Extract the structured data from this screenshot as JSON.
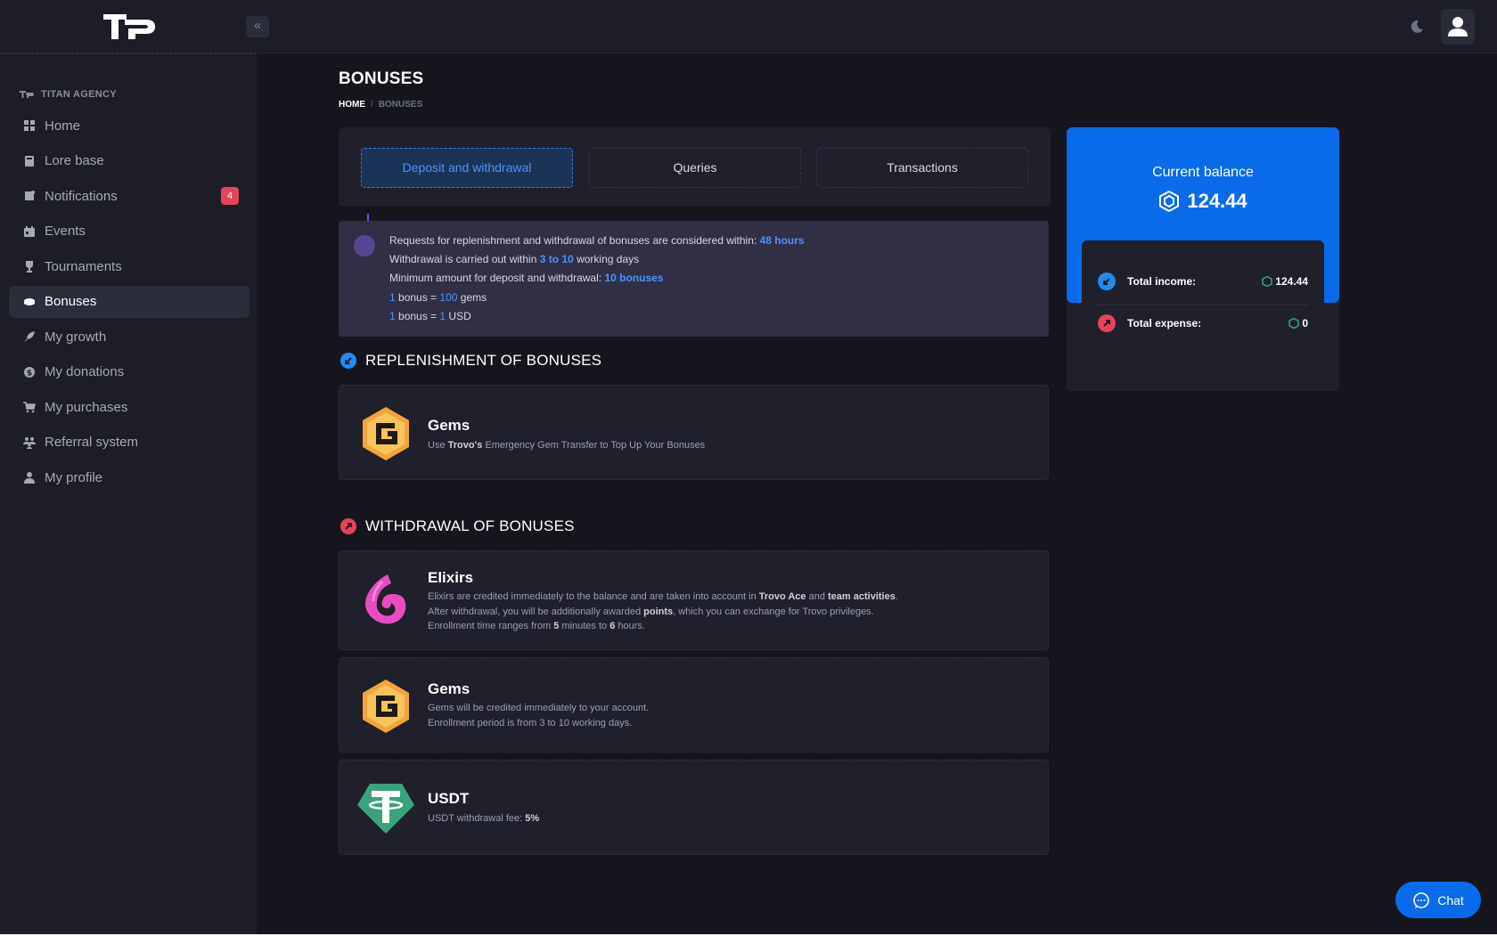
{
  "header": {
    "collapse_label": "«"
  },
  "sidebar": {
    "agency": "TITAN AGENCY",
    "items": [
      {
        "label": "Home"
      },
      {
        "label": "Lore base"
      },
      {
        "label": "Notifications",
        "badge": "4"
      },
      {
        "label": "Events"
      },
      {
        "label": "Tournaments"
      },
      {
        "label": "Bonuses",
        "active": true
      },
      {
        "label": "My growth"
      },
      {
        "label": "My donations"
      },
      {
        "label": "My purchases"
      },
      {
        "label": "Referral system"
      },
      {
        "label": "My profile"
      }
    ]
  },
  "page": {
    "title": "BONUSES",
    "breadcrumb": {
      "home": "HOME",
      "separator": "/",
      "current": "BONUSES"
    }
  },
  "tabs": [
    {
      "label": "Deposit and withdrawal",
      "active": true
    },
    {
      "label": "Queries"
    },
    {
      "label": "Transactions"
    }
  ],
  "info": {
    "line1_text": "Requests for replenishment and withdrawal of bonuses are considered within: ",
    "line1_hl": "48 hours",
    "line2_text": "Withdrawal is carried out within ",
    "line2_hl": "3 to 10",
    "line2_end": " working days",
    "line3_text": "Minimum amount for deposit and withdrawal: ",
    "line3_hl": "10 bonuses",
    "line4_a": "1",
    "line4_b": " bonus = ",
    "line4_c": "100",
    "line4_d": " gems",
    "line5_a": "1",
    "line5_b": " bonus = ",
    "line5_c": "1",
    "line5_d": " USD"
  },
  "replenishment": {
    "title": "REPLENISHMENT OF BONUSES",
    "gems": {
      "title": "Gems",
      "desc_a": "Use ",
      "desc_b": "Trovo's",
      "desc_c": " Emergency Gem Transfer to Top Up Your Bonuses"
    }
  },
  "withdrawal": {
    "title": "WITHDRAWAL OF BONUSES",
    "elixirs": {
      "title": "Elixirs",
      "l1_a": "Elixirs are credited immediately to the balance and are taken into account in ",
      "l1_b": "Trovo Ace",
      "l1_c": " and ",
      "l1_d": "team activities",
      "l1_e": ".",
      "l2_a": "After withdrawal, you will be additionally awarded ",
      "l2_b": "points",
      "l2_c": ", which you can exchange for Trovo privileges.",
      "l3_a": "Enrollment time ranges from ",
      "l3_b": "5",
      "l3_c": " minutes to ",
      "l3_d": "6",
      "l3_e": " hours."
    },
    "gems": {
      "title": "Gems",
      "l1": "Gems will be credited immediately to your account.",
      "l2": "Enrollment period is from 3 to 10 working days."
    },
    "usdt": {
      "title": "USDT",
      "l1_a": "USDT withdrawal fee: ",
      "l1_b": "5%"
    }
  },
  "balance": {
    "label": "Current balance",
    "value": "124.44",
    "income_label": "Total income:",
    "income_value": "124.44",
    "expense_label": "Total expense:",
    "expense_value": "0"
  },
  "chat": {
    "label": "Chat"
  },
  "colors": {
    "accent": "#0a6bea",
    "danger": "#e8425b",
    "gem": "#f2a43a",
    "usdt": "#3aa37d"
  }
}
